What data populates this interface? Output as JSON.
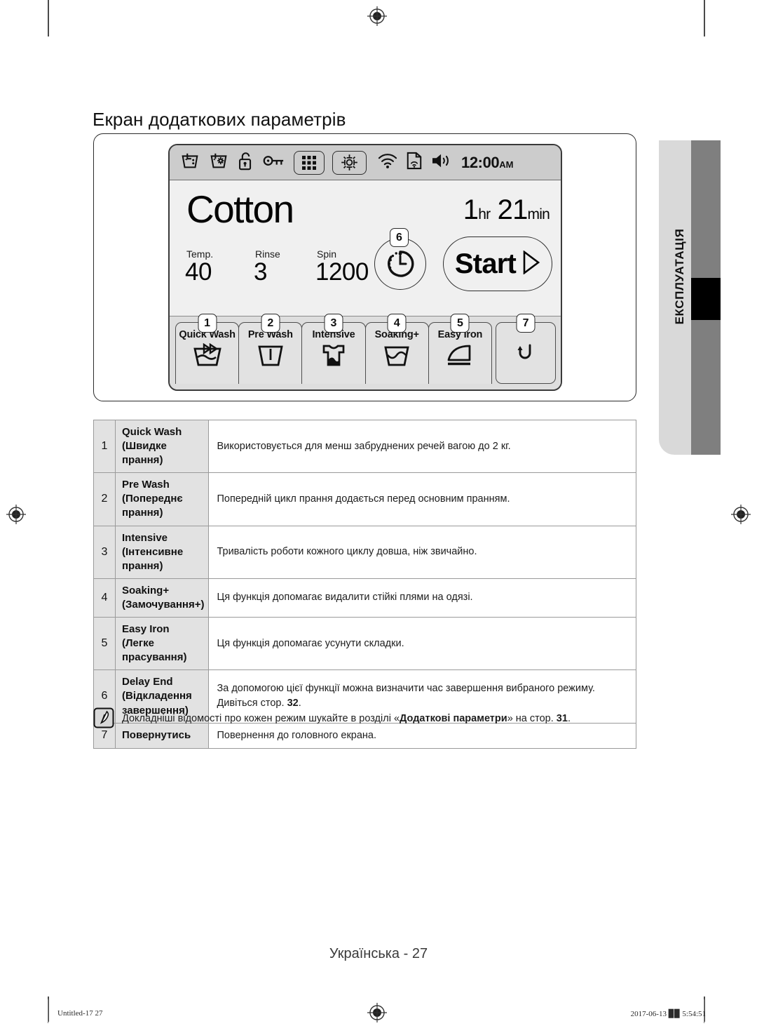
{
  "page": {
    "title": "Екран додаткових параметрів",
    "footer_language": "Українська - 27",
    "side_tab_label": "ЕКСПЛУАТАЦІЯ"
  },
  "display": {
    "status_bar": {
      "icons": [
        {
          "name": "detergent-dispenser-icon",
          "label": "Detergent"
        },
        {
          "name": "softener-dispenser-icon",
          "label": "Softener"
        },
        {
          "name": "child-lock-open-icon",
          "label": "Child Lock"
        },
        {
          "name": "key-icon",
          "label": "Key"
        },
        {
          "name": "grid-menu-icon",
          "label": "Menu"
        },
        {
          "name": "settings-gear-icon",
          "label": "Settings"
        },
        {
          "name": "wifi-icon",
          "label": "Wi-Fi"
        },
        {
          "name": "smart-control-icon",
          "label": "Smart Control"
        },
        {
          "name": "volume-icon",
          "label": "Sound"
        }
      ],
      "clock": "12:00",
      "clock_ampm": "AM"
    },
    "cycle_name": "Cotton",
    "time_remaining": {
      "hours": "1",
      "hours_unit": "hr",
      "minutes": "21",
      "minutes_unit": "min"
    },
    "params": [
      {
        "label": "Temp.",
        "value": "40"
      },
      {
        "label": "Rinse",
        "value": "3"
      },
      {
        "label": "Spin",
        "value": "1200"
      }
    ],
    "delay_end": {
      "badge": "6",
      "icon": "delay-end-clock-icon"
    },
    "start_button": {
      "label": "Start",
      "icon": "play-triangle-icon"
    },
    "options": [
      {
        "badge": "1",
        "label": "Quick Wash",
        "icon": "quick-wash-icon"
      },
      {
        "badge": "2",
        "label": "Pre Wash",
        "icon": "pre-wash-icon"
      },
      {
        "badge": "3",
        "label": "Intensive",
        "icon": "intensive-tshirt-icon"
      },
      {
        "badge": "4",
        "label": "Soaking+",
        "icon": "soaking-basin-icon"
      },
      {
        "badge": "5",
        "label": "Easy Iron",
        "icon": "easy-iron-icon"
      },
      {
        "badge": "7",
        "label": "",
        "icon": "back-arrow-icon"
      }
    ]
  },
  "table": {
    "rows": [
      {
        "num": "1",
        "name": "Quick Wash (Швидке прання)",
        "desc": "Використовується для менш забруднених речей вагою до 2 кг."
      },
      {
        "num": "2",
        "name": "Pre Wash (Попереднє прання)",
        "desc": "Попередній цикл прання додається перед основним пранням."
      },
      {
        "num": "3",
        "name": "Intensive (Інтенсивне прання)",
        "desc": "Тривалість роботи кожного циклу довша, ніж звичайно."
      },
      {
        "num": "4",
        "name": "Soaking+ (Замочування+)",
        "desc": "Ця функція допомагає видалити стійкі плями на одязі."
      },
      {
        "num": "5",
        "name": "Easy Iron (Легке прасування)",
        "desc": "Ця функція допомагає усунути складки."
      },
      {
        "num": "6",
        "name": "Delay End (Відкладення завершення)",
        "desc_pre": "За допомогою цієї функції можна визначити час завершення вибраного режиму. Дивіться стор. ",
        "desc_bold": "32",
        "desc_post": "."
      },
      {
        "num": "7",
        "name": "Повернутись",
        "desc": "Повернення до головного екрана."
      }
    ]
  },
  "note": {
    "icon": "note-pen-icon",
    "text_pre": "Докладніші відомості про кожен режим шукайте в розділі «",
    "text_bold": "Додаткові параметри",
    "text_mid": "» на стор. ",
    "text_bold2": "31",
    "text_post": "."
  },
  "print_footer": {
    "left": "Untitled-17   27",
    "right": "2017-06-13   ▉▉ 5:54:51"
  }
}
